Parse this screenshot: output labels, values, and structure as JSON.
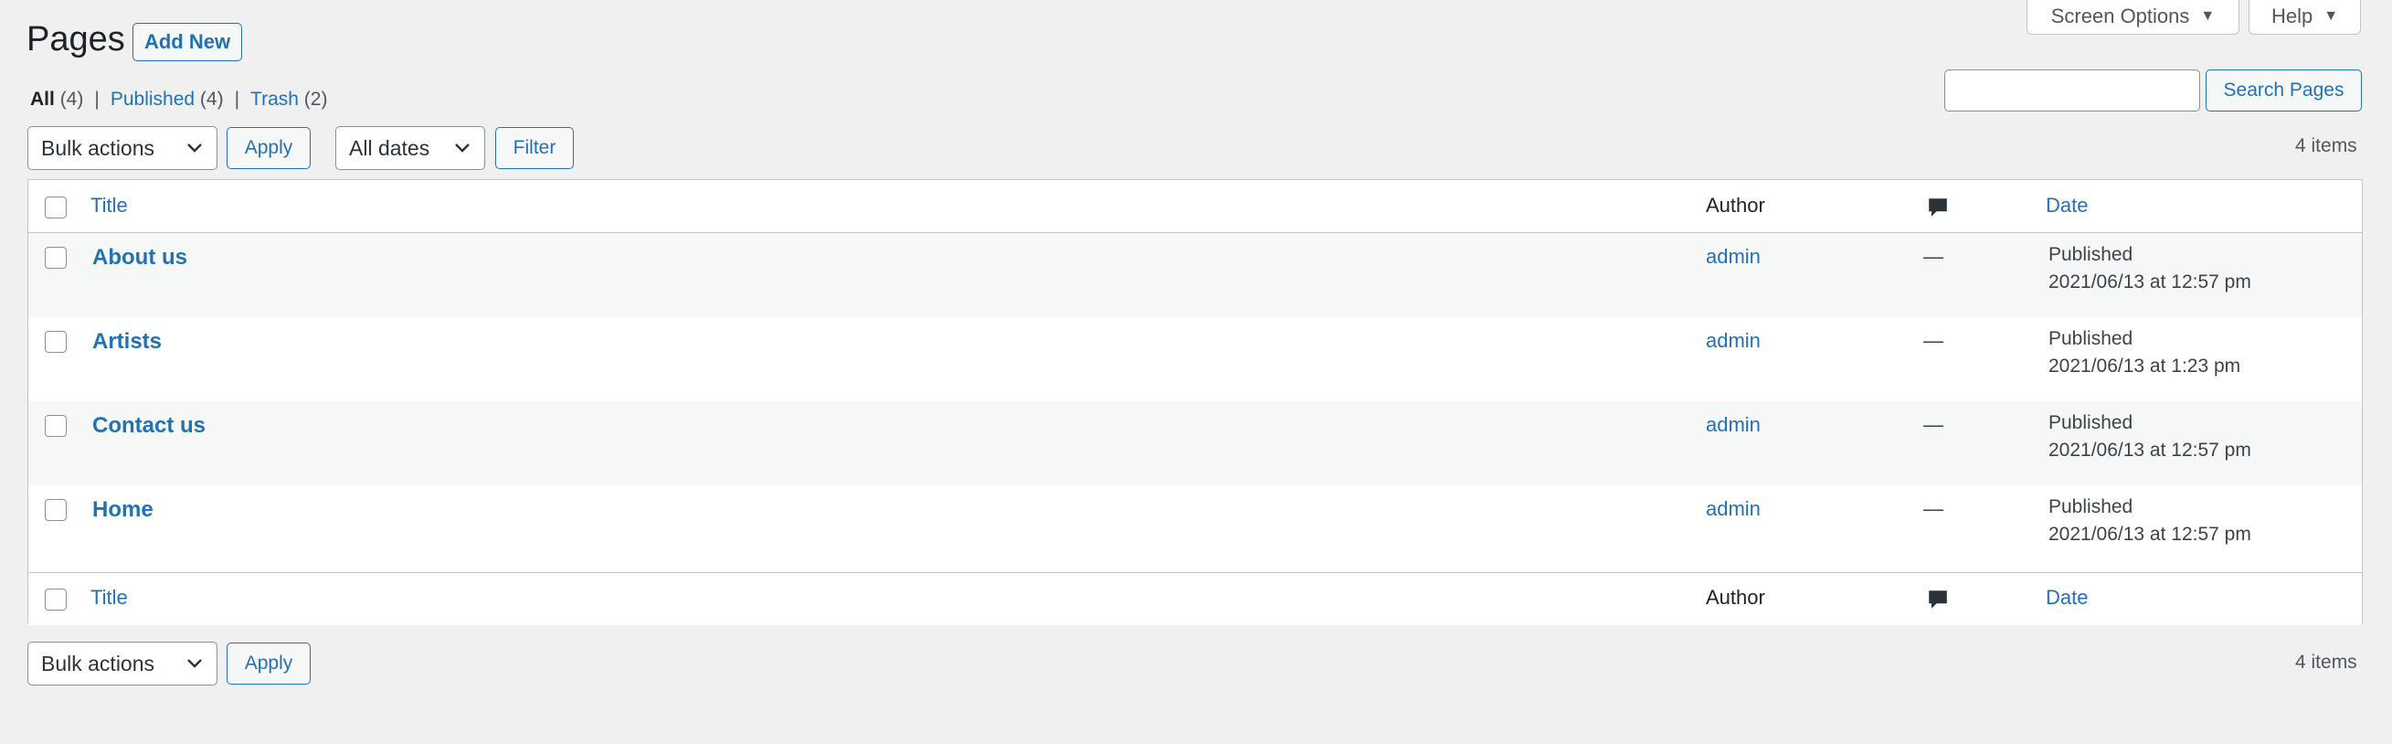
{
  "screen_tabs": {
    "screen_options": "Screen Options",
    "help": "Help"
  },
  "header": {
    "title": "Pages",
    "add_new": "Add New"
  },
  "filters": {
    "all_label": "All",
    "all_count": "(4)",
    "published_label": "Published",
    "published_count": "(4)",
    "trash_label": "Trash",
    "trash_count": "(2)",
    "separator": "|"
  },
  "search": {
    "value": "",
    "button": "Search Pages"
  },
  "toolbar_top": {
    "bulk_actions": "Bulk actions",
    "apply": "Apply",
    "dates": "All dates",
    "filter": "Filter",
    "items": "4 items"
  },
  "table": {
    "columns": {
      "title": "Title",
      "author": "Author",
      "date": "Date"
    },
    "rows": [
      {
        "title": "About us",
        "author": "admin",
        "comments": "—",
        "status": "Published",
        "date": "2021/06/13 at 12:57 pm"
      },
      {
        "title": "Artists",
        "author": "admin",
        "comments": "—",
        "status": "Published",
        "date": "2021/06/13 at 1:23 pm"
      },
      {
        "title": "Contact us",
        "author": "admin",
        "comments": "—",
        "status": "Published",
        "date": "2021/06/13 at 12:57 pm"
      },
      {
        "title": "Home",
        "author": "admin",
        "comments": "—",
        "status": "Published",
        "date": "2021/06/13 at 12:57 pm"
      }
    ]
  },
  "toolbar_bottom": {
    "bulk_actions": "Bulk actions",
    "apply": "Apply",
    "items": "4 items"
  },
  "icons": {
    "comment": "comment-bubble-icon",
    "dropdown": "chevron-down-icon",
    "tab_toggle": "triangle-down-icon"
  },
  "colors": {
    "accent": "#2271b1",
    "background": "#f0f0f1",
    "border": "#c3c4c7",
    "text": "#1d2327"
  }
}
